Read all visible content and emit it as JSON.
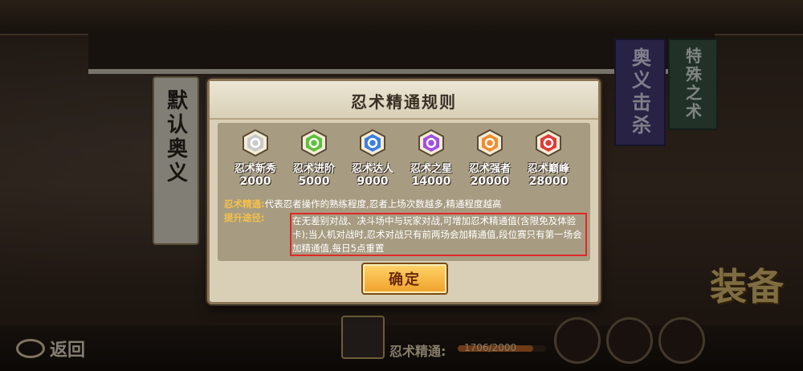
{
  "background": {
    "left_banner": "默认奥义",
    "purple_banner": "奥义击杀",
    "green_banner": "特殊之术",
    "equip_label": "装备"
  },
  "bottom": {
    "back_label": "返回",
    "mastery_label": "忍术精通:",
    "mastery_value": "1706/2000",
    "mastery_fraction": 0.853
  },
  "modal": {
    "title": "忍术精通规则",
    "ranks": [
      {
        "name": "忍术新秀",
        "value": "2000",
        "color": "#c9c9c9",
        "icon": "rank-rookie-icon"
      },
      {
        "name": "忍术进阶",
        "value": "5000",
        "color": "#5cc13a",
        "icon": "rank-advanced-icon"
      },
      {
        "name": "忍术达人",
        "value": "9000",
        "color": "#3a7fe0",
        "icon": "rank-expert-icon"
      },
      {
        "name": "忍术之星",
        "value": "14000",
        "color": "#a14fe0",
        "icon": "rank-star-icon"
      },
      {
        "name": "忍术强者",
        "value": "20000",
        "color": "#f08c30",
        "icon": "rank-strong-icon"
      },
      {
        "name": "忍术巅峰",
        "value": "28000",
        "color": "#e03a3a",
        "icon": "rank-peak-icon"
      }
    ],
    "rule1_label": "忍术精通:",
    "rule1_text": "代表忍者操作的熟练程度,忍者上场次数越多,精通程度越高",
    "rule2_label": "提升途径:",
    "rule2_text": "在无差别对战、决斗场中与玩家对战,可增加忍术精通值(含限免及体验卡);当人机对战时,忍术对战只有前两场会加精通值,段位赛只有第一场会加精通值,每日5点重置",
    "confirm_label": "确定"
  }
}
